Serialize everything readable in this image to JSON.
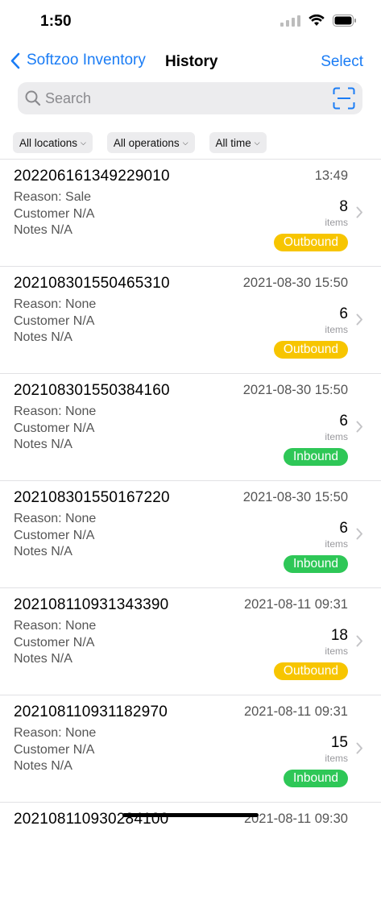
{
  "status_bar": {
    "time": "1:50"
  },
  "nav": {
    "back_label": "Softzoo Inventory",
    "title": "History",
    "select_label": "Select"
  },
  "search": {
    "placeholder": "Search"
  },
  "filters": [
    {
      "label": "All locations"
    },
    {
      "label": "All operations"
    },
    {
      "label": "All time"
    }
  ],
  "items": [
    {
      "id": "20220616134922​9010",
      "time": "13:49",
      "reason": "Reason: Sale",
      "customer": "Customer N/A",
      "notes": "Notes N/A",
      "count": "8",
      "count_label": "items",
      "status": "Outbound"
    },
    {
      "id": "202108301550465310",
      "time": "2021-08-30 15:50",
      "reason": "Reason: None",
      "customer": "Customer N/A",
      "notes": "Notes N/A",
      "count": "6",
      "count_label": "items",
      "status": "Outbound"
    },
    {
      "id": "202108301550384160",
      "time": "2021-08-30 15:50",
      "reason": "Reason: None",
      "customer": "Customer N/A",
      "notes": "Notes N/A",
      "count": "6",
      "count_label": "items",
      "status": "Inbound"
    },
    {
      "id": "202108301550167220",
      "time": "2021-08-30 15:50",
      "reason": "Reason: None",
      "customer": "Customer N/A",
      "notes": "Notes N/A",
      "count": "6",
      "count_label": "items",
      "status": "Inbound"
    },
    {
      "id": "202108110931343390",
      "time": "2021-08-11 09:31",
      "reason": "Reason: None",
      "customer": "Customer N/A",
      "notes": "Notes N/A",
      "count": "18",
      "count_label": "items",
      "status": "Outbound"
    },
    {
      "id": "202108110931182970",
      "time": "2021-08-11 09:31",
      "reason": "Reason: None",
      "customer": "Customer N/A",
      "notes": "Notes N/A",
      "count": "15",
      "count_label": "items",
      "status": "Inbound"
    },
    {
      "id": "202108110930284100",
      "time": "2021-08-11 09:30",
      "reason": "",
      "customer": "",
      "notes": "",
      "count": "",
      "count_label": "",
      "status": ""
    }
  ],
  "colors": {
    "accent": "#1a7cf5",
    "outbound": "#f7c500",
    "inbound": "#2ec757"
  }
}
